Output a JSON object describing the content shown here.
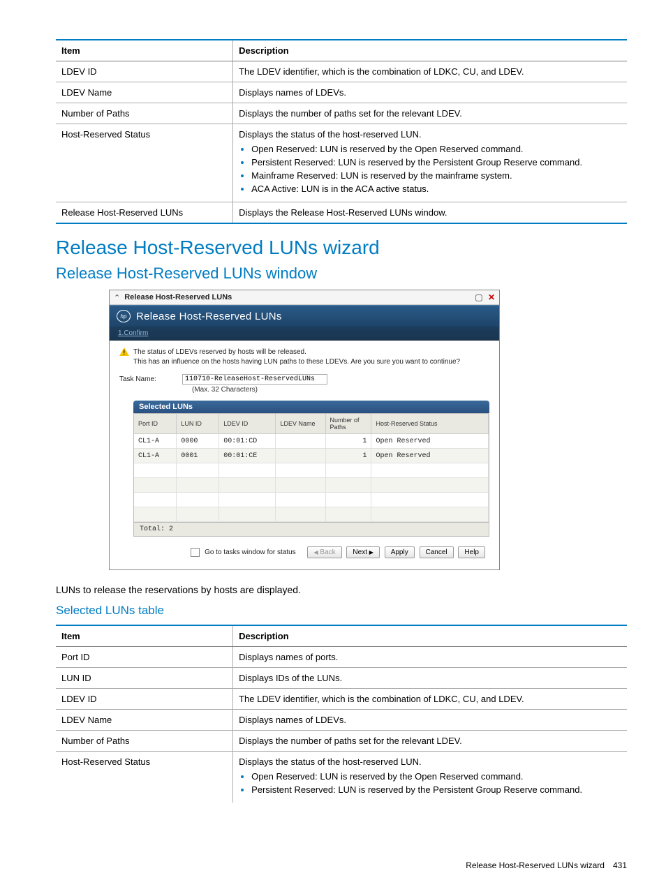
{
  "table1": {
    "headers": [
      "Item",
      "Description"
    ],
    "rows": [
      {
        "item": "LDEV ID",
        "desc": "The LDEV identifier, which is the combination of LDKC, CU, and LDEV."
      },
      {
        "item": "LDEV Name",
        "desc": "Displays names of LDEVs."
      },
      {
        "item": "Number of Paths",
        "desc": "Displays the number of paths set for the relevant LDEV."
      },
      {
        "item": "Host-Reserved Status",
        "desc": "Displays the status of the host-reserved LUN.",
        "bullets": [
          "Open Reserved: LUN is reserved by the Open Reserved command.",
          "Persistent Reserved: LUN is reserved by the Persistent Group Reserve command.",
          "Mainframe Reserved: LUN is reserved by the mainframe system.",
          "ACA Active: LUN is in the ACA active status."
        ]
      },
      {
        "item": "Release Host-Reserved LUNs",
        "desc": "Displays the Release Host-Reserved LUNs window."
      }
    ]
  },
  "heading_wizard": "Release Host-Reserved LUNs wizard",
  "heading_window": "Release Host-Reserved LUNs window",
  "wizard": {
    "titlebar": "Release Host-Reserved LUNs",
    "header": "Release Host-Reserved LUNs",
    "step": "1.Confirm",
    "warning_line1": "The status of LDEVs reserved by hosts will be released.",
    "warning_line2": "This has an influence on the hosts having LUN paths to these LDEVs. Are you sure you want to continue?",
    "task_label": "Task Name:",
    "task_value": "110710-ReleaseHost-ReservedLUNs",
    "task_note": "(Max. 32 Characters)",
    "selected_title": "Selected LUNs",
    "cols": [
      "Port ID",
      "LUN ID",
      "LDEV ID",
      "LDEV Name",
      "Number of Paths",
      "Host-Reserved Status"
    ],
    "rows": [
      [
        "CL1-A",
        "0000",
        "00:01:CD",
        "",
        "1",
        "Open Reserved"
      ],
      [
        "CL1-A",
        "0001",
        "00:01:CE",
        "",
        "1",
        "Open Reserved"
      ]
    ],
    "total_label": "Total: 2",
    "checkbox_label": "Go to tasks window for status",
    "buttons": {
      "back": "Back",
      "next": "Next",
      "apply": "Apply",
      "cancel": "Cancel",
      "help": "Help"
    }
  },
  "body_text": "LUNs to release the reservations by hosts are displayed.",
  "heading_selected": "Selected LUNs table",
  "table2": {
    "headers": [
      "Item",
      "Description"
    ],
    "rows": [
      {
        "item": "Port ID",
        "desc": "Displays names of ports."
      },
      {
        "item": "LUN ID",
        "desc": "Displays IDs of the LUNs."
      },
      {
        "item": "LDEV ID",
        "desc": "The LDEV identifier, which is the combination of LDKC, CU, and LDEV."
      },
      {
        "item": "LDEV Name",
        "desc": "Displays names of LDEVs."
      },
      {
        "item": "Number of Paths",
        "desc": "Displays the number of paths set for the relevant LDEV."
      },
      {
        "item": "Host-Reserved Status",
        "desc": "Displays the status of the host-reserved LUN.",
        "bullets": [
          "Open Reserved: LUN is reserved by the Open Reserved command.",
          "Persistent Reserved: LUN is reserved by the Persistent Group Reserve command."
        ]
      }
    ]
  },
  "footer_label": "Release Host-Reserved LUNs wizard",
  "footer_page": "431"
}
